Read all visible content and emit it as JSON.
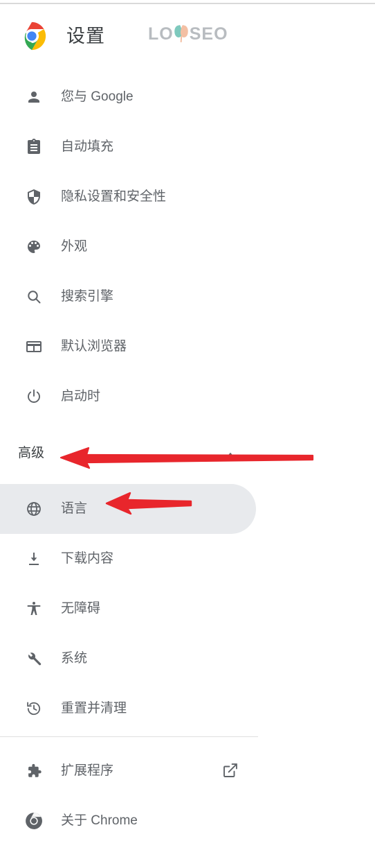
{
  "window": {
    "app": "Chrome 设置",
    "title": "设置"
  },
  "header": {
    "title": "设置",
    "logo_icon": "chrome-logo-icon"
  },
  "watermark": {
    "text_left": "LO",
    "text_right": "SEO",
    "full_text": "LOVSEO",
    "color_gray": "#b8bcc0",
    "color_leaf_teal": "#7ec9bd",
    "color_leaf_peach": "#f3bfa3"
  },
  "theme": {
    "text_color": "#5f6368",
    "heading_color": "#3c4043",
    "selected_background": "#e8eaed",
    "divider_color": "#e0e0e0",
    "annotation_color": "#e8262c"
  },
  "sidebar": {
    "basic_items": [
      {
        "label": "您与 Google",
        "icon": "person-icon",
        "selected": false
      },
      {
        "label": "自动填充",
        "icon": "clipboard-icon",
        "selected": false
      },
      {
        "label": "隐私设置和安全性",
        "icon": "shield-icon",
        "selected": false
      },
      {
        "label": "外观",
        "icon": "palette-icon",
        "selected": false
      },
      {
        "label": "搜索引擎",
        "icon": "search-icon",
        "selected": false
      },
      {
        "label": "默认浏览器",
        "icon": "browser-window-icon",
        "selected": false
      },
      {
        "label": "启动时",
        "icon": "power-icon",
        "selected": false
      }
    ],
    "advanced": {
      "label": "高级",
      "expanded": true,
      "chevron_icon": "chevron-up-icon"
    },
    "advanced_items": [
      {
        "label": "语言",
        "icon": "globe-icon",
        "selected": true
      },
      {
        "label": "下载内容",
        "icon": "download-icon",
        "selected": false
      },
      {
        "label": "无障碍",
        "icon": "accessibility-icon",
        "selected": false
      },
      {
        "label": "系统",
        "icon": "wrench-icon",
        "selected": false
      },
      {
        "label": "重置并清理",
        "icon": "restore-history-icon",
        "selected": false
      }
    ],
    "footer_items": [
      {
        "label": "扩展程序",
        "icon": "puzzle-piece-icon",
        "trailing_icon": "external-link-icon",
        "selected": false
      },
      {
        "label": "关于 Chrome",
        "icon": "chrome-mono-icon",
        "trailing_icon": "",
        "selected": false
      }
    ]
  },
  "annotations": [
    {
      "name": "arrow-to-advanced",
      "shape": "left-arrow",
      "target": "高级"
    },
    {
      "name": "arrow-to-language",
      "shape": "left-arrow",
      "target": "语言"
    }
  ]
}
